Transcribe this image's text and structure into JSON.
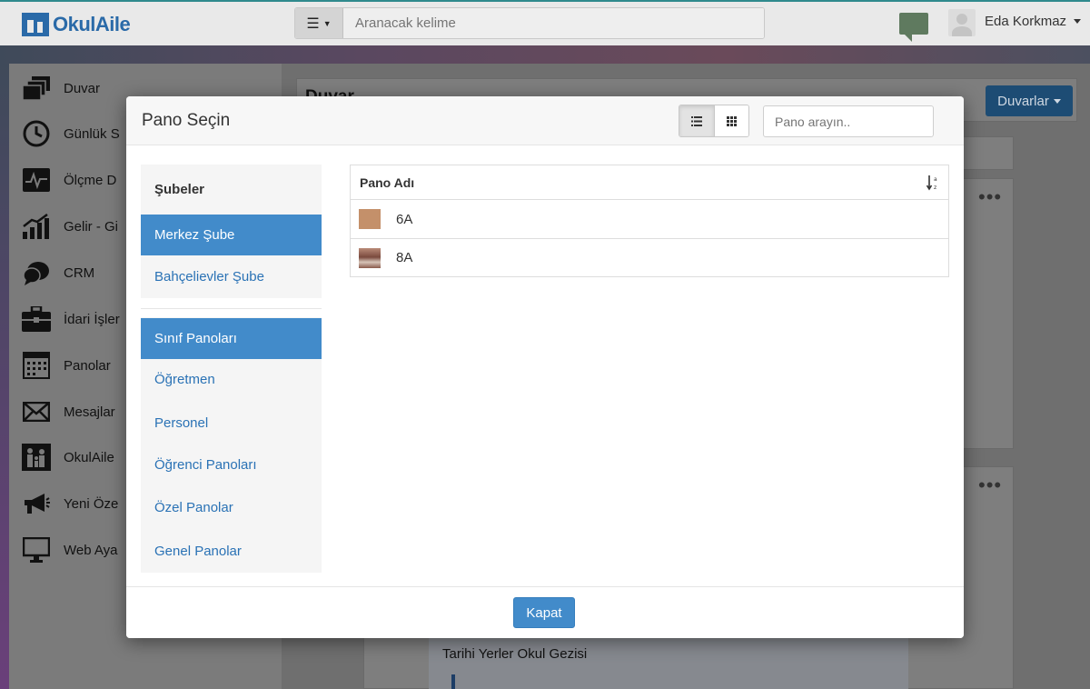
{
  "header": {
    "brand": "OkulAile",
    "search_placeholder": "Aranacak kelime",
    "user_name": "Eda Korkmaz"
  },
  "sidebar": {
    "items": [
      {
        "label": "Duvar",
        "icon": "wall-icon"
      },
      {
        "label": "Günlük S",
        "icon": "clock-icon"
      },
      {
        "label": "Ölçme D",
        "icon": "chart-icon"
      },
      {
        "label": "Gelir - Gi",
        "icon": "growth-chart-icon"
      },
      {
        "label": "CRM",
        "icon": "crm-icon"
      },
      {
        "label": "İdari İşler",
        "icon": "briefcase-icon"
      },
      {
        "label": "Panolar",
        "icon": "calendar-grid-icon"
      },
      {
        "label": "Mesajlar",
        "icon": "envelope-icon"
      },
      {
        "label": "OkulAile",
        "icon": "family-icon"
      },
      {
        "label": "Yeni Öze",
        "icon": "megaphone-icon"
      },
      {
        "label": "Web Aya",
        "icon": "monitor-icon"
      }
    ]
  },
  "page": {
    "title": "Duvar",
    "walls_button": "Duvarlar",
    "post_title": "Tarihi Yerler Okul Gezisi"
  },
  "modal": {
    "title": "Pano Seçin",
    "search_placeholder": "Pano arayın..",
    "view_mode": "list",
    "branches": {
      "heading": "Şubeler",
      "items": [
        {
          "label": "Merkez Şube",
          "active": true
        },
        {
          "label": "Bahçelievler Şube",
          "active": false
        }
      ]
    },
    "categories": {
      "items": [
        {
          "label": "Sınıf Panoları",
          "active": true
        },
        {
          "label": "Öğretmen",
          "active": false
        },
        {
          "label": "Personel",
          "active": false
        },
        {
          "label": "Öğrenci Panoları",
          "active": false
        },
        {
          "label": "Özel Panolar",
          "active": false
        },
        {
          "label": "Genel Panolar",
          "active": false
        }
      ]
    },
    "table": {
      "column_header": "Pano Adı",
      "rows": [
        {
          "name": "6A",
          "thumb_color": "#c4906a"
        },
        {
          "name": "8A",
          "thumb_color": "#9b6b58"
        }
      ]
    },
    "close_button": "Kapat"
  },
  "colors": {
    "primary": "#428bca",
    "link": "#2a72b5",
    "brand": "#2a6aa8"
  }
}
